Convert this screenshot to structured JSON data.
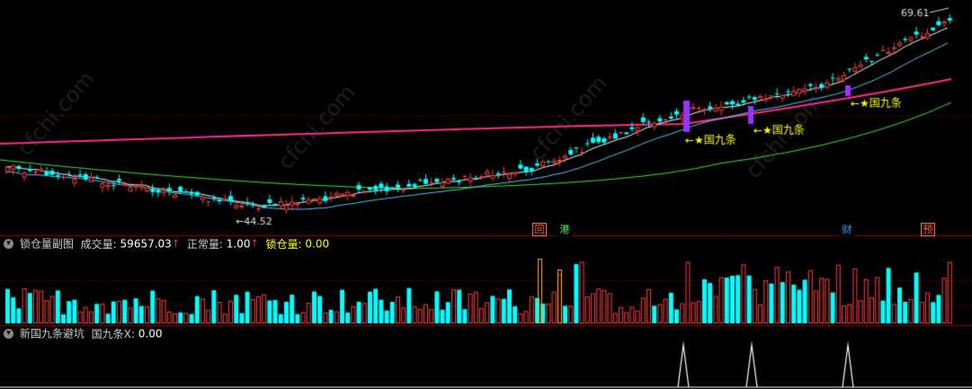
{
  "main_panel": {
    "high_label": "69.61",
    "low_label": "←44.52",
    "ann_label": "←★国九条"
  },
  "event_markers": [
    {
      "key": "hui",
      "text": "回",
      "color": "#ff6633"
    },
    {
      "key": "gang",
      "text": "港",
      "color": "#33ff33"
    },
    {
      "key": "cai",
      "text": "财",
      "color": "#3399ff"
    },
    {
      "key": "yu",
      "text": "预",
      "color": "#ff6633"
    }
  ],
  "volume_panel": {
    "title": "锁仓量副图",
    "vol_label": "成交量:",
    "vol_value": "59657.03",
    "normal_label": "正常量:",
    "normal_value": "1.00",
    "lock_label": "锁仓量:",
    "lock_value": "0.00"
  },
  "signal_panel": {
    "title": "新国九条避坑",
    "x_label": "国九条X:",
    "x_value": "0.00"
  },
  "watermark": "cfchi.com",
  "colors": {
    "up": "#ff3c3c",
    "down": "#00ffff",
    "ma_long": "#ff2d8a",
    "ma_green": "#35e835",
    "ma_cyan": "#50c8ff",
    "ma_white": "#ffffff",
    "grid": "#8b0000",
    "highlight": "#9b30ff"
  }
}
